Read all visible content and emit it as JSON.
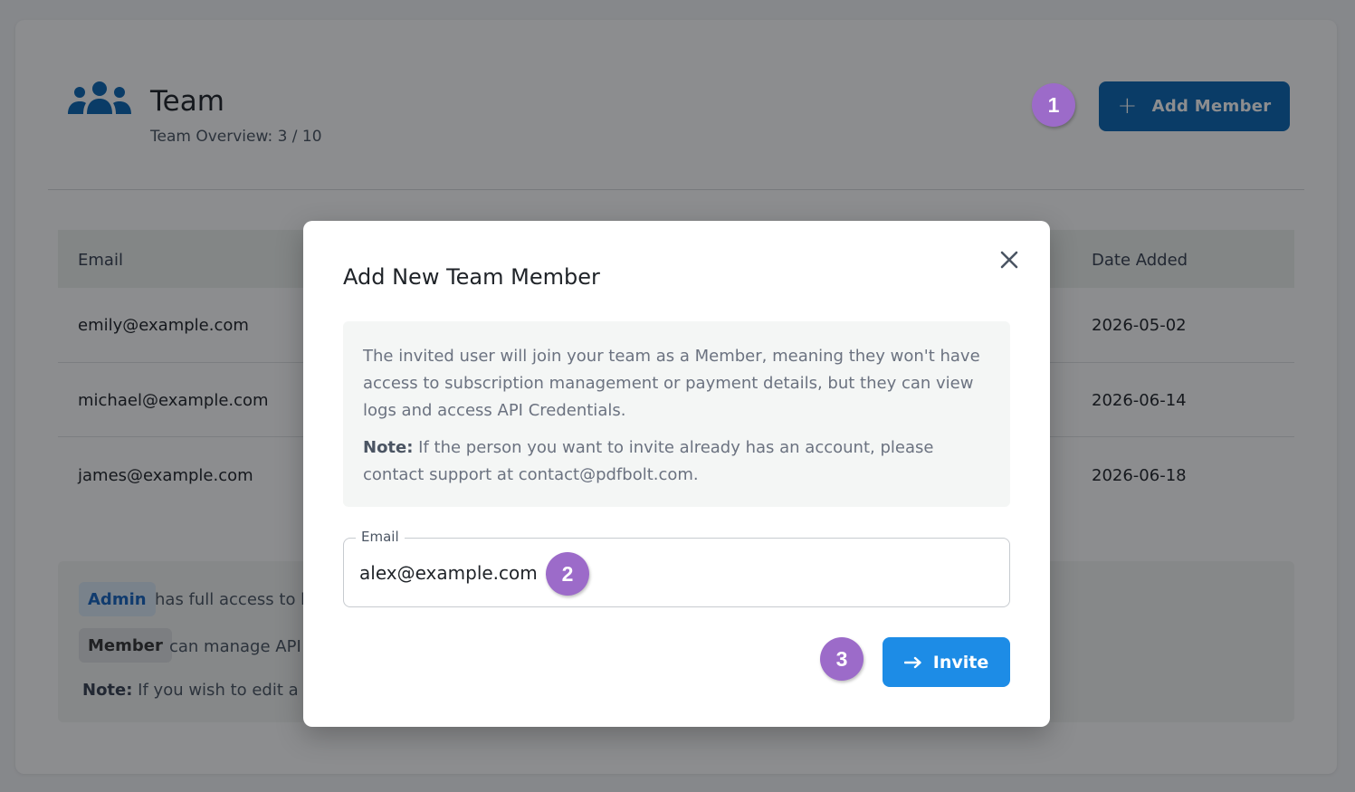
{
  "header": {
    "title": "Team",
    "subtitle": "Team Overview: 3 / 10",
    "add_member_label": "Add Member"
  },
  "steps": [
    "1",
    "2",
    "3"
  ],
  "table": {
    "columns": [
      "Email",
      "Date Added"
    ],
    "rows": [
      {
        "email": "emily@example.com",
        "date_added": "2026-05-02"
      },
      {
        "email": "michael@example.com",
        "date_added": "2026-06-14"
      },
      {
        "email": "james@example.com",
        "date_added": "2026-06-18"
      }
    ]
  },
  "roles": {
    "admin_tag": "Admin",
    "admin_text": "has full access to bi",
    "member_tag": "Member",
    "member_text": "can manage API C",
    "note_label": "Note:",
    "note_text": " If you wish to edit a te"
  },
  "modal": {
    "title": "Add New Team Member",
    "info_text": "The invited user will join your team as a Member, meaning they won't have access to subscription management or payment details, but they can view logs and access API Credentials.",
    "note_label": "Note:",
    "note_text": " If the person you want to invite already has an account, please contact support at contact@pdfbolt.com.",
    "email_label": "Email",
    "email_value": "alex@example.com",
    "invite_label": "Invite"
  },
  "colors": {
    "primary": "#0b66b3",
    "invite": "#1d8ce6",
    "step_badge": "#9c6bc9",
    "admin_tag_bg": "#dbeaf7"
  },
  "icons": [
    "team-icon",
    "plus-icon",
    "close-icon",
    "arrow-right-icon"
  ]
}
